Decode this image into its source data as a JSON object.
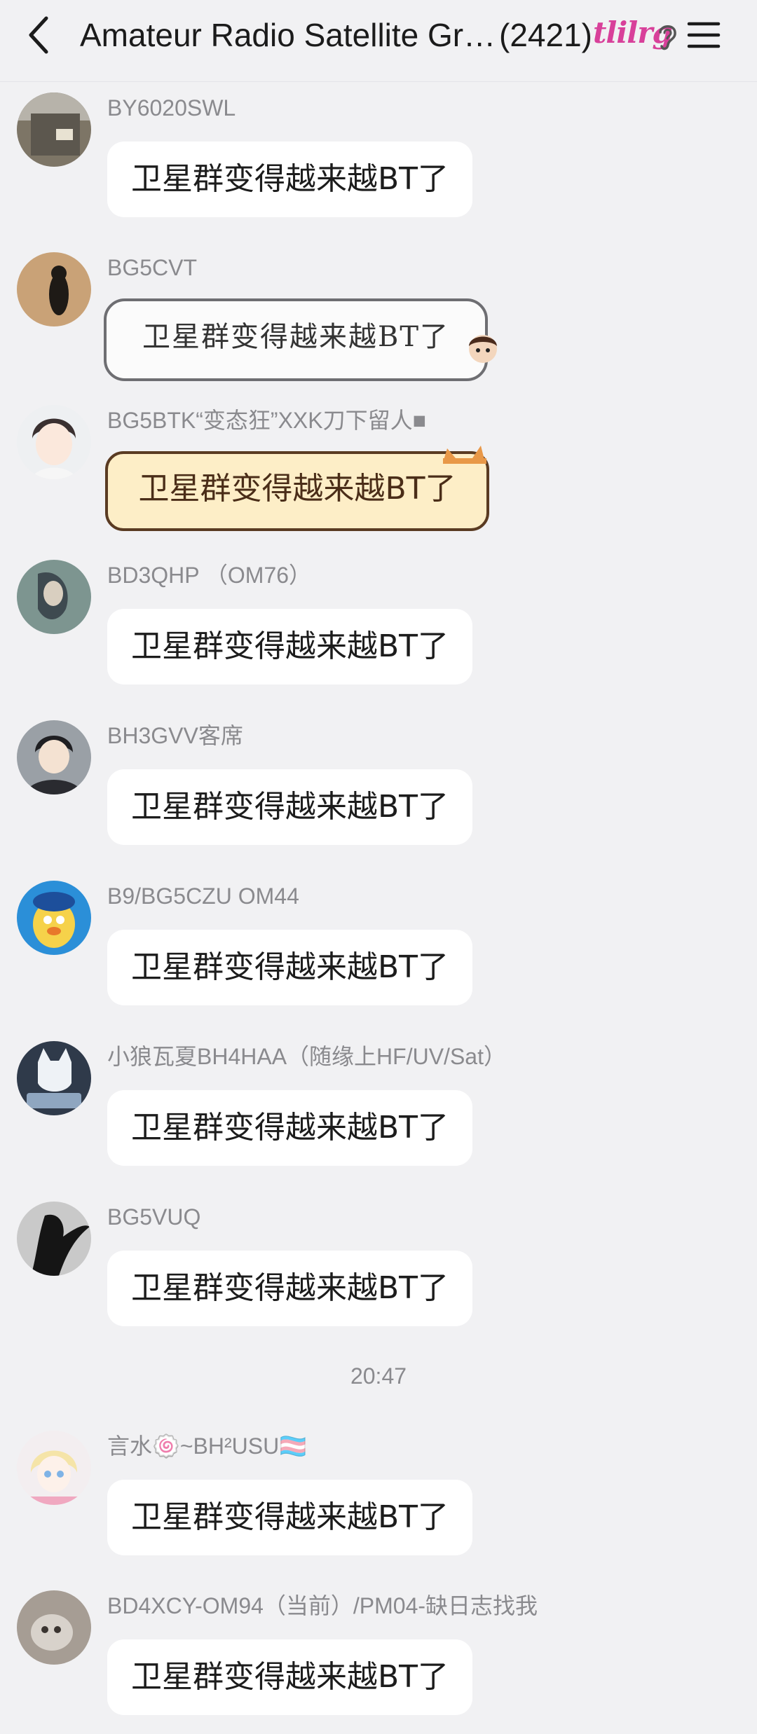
{
  "header": {
    "title": "Amateur Radio Satellite Gr…",
    "member_count": "(2421)",
    "badge": "tlilrg"
  },
  "messages": [
    {
      "sender": "BY6020SWL",
      "text": "卫星群变得越来越BT了"
    },
    {
      "sender": "BG5CVT",
      "text": "卫星群变得越来越BT了"
    },
    {
      "sender": "BG5BTK“变态狂”XXK刀下留人■",
      "text": "卫星群变得越来越BT了"
    },
    {
      "sender": "BD3QHP （OM76）",
      "text": "卫星群变得越来越BT了"
    },
    {
      "sender": "BH3GVV客席",
      "text": "卫星群变得越来越BT了"
    },
    {
      "sender": "B9/BG5CZU OM44",
      "text": "卫星群变得越来越BT了"
    },
    {
      "sender": "小狼瓦夏BH4HAA（随缘上HF/UV/Sat）",
      "text": "卫星群变得越来越BT了"
    },
    {
      "sender": "BG5VUQ",
      "text": "卫星群变得越来越BT了"
    },
    {
      "sender": "言水🍥~BH²USU🏳️‍⚧️",
      "text": "卫星群变得越来越BT了"
    },
    {
      "sender": "BD4XCY-OM94（当前）/PM04-缺日志找我",
      "text": "卫星群变得越来越BT了"
    }
  ],
  "timestamp": "20:47",
  "colors": {
    "background": "#f1f1f3",
    "bubble": "#ffffff",
    "sender_text": "#8a8a8e",
    "badge": "#d8409a",
    "cat_bubble": "#fdeec7"
  }
}
